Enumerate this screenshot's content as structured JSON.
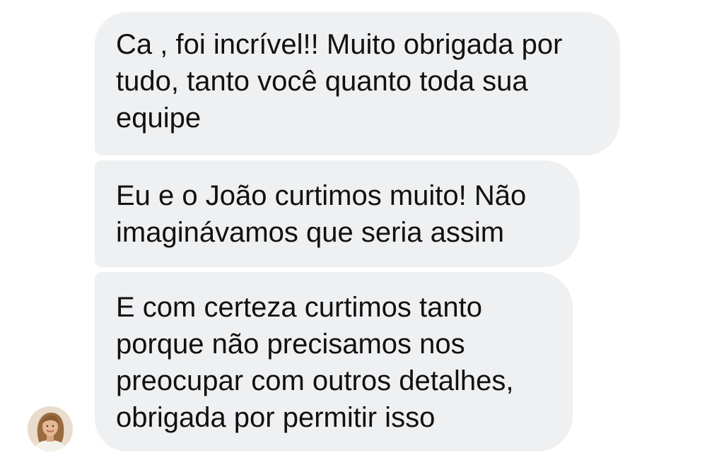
{
  "conversation": {
    "messages": [
      {
        "lines": [
          "Ca , foi incrível!! Muito obrigada por",
          "tudo, tanto você quanto toda sua",
          "equipe"
        ]
      },
      {
        "lines": [
          "Eu e o João curtimos muito! Não",
          "imaginávamos que seria assim"
        ]
      },
      {
        "lines": [
          "E com certeza curtimos tanto",
          "porque não precisamos nos",
          "preocupar com outros detalhes,",
          "obrigada por permitir isso"
        ]
      }
    ],
    "sender_avatar": {
      "icon": "user-photo-avatar",
      "colors": {
        "background": "#e9dccd",
        "hair": "#9a6b3f",
        "skin": "#e6b896",
        "top": "#f4f1ea"
      }
    },
    "bubble_color": "#eff0f2",
    "text_color": "#111111"
  }
}
